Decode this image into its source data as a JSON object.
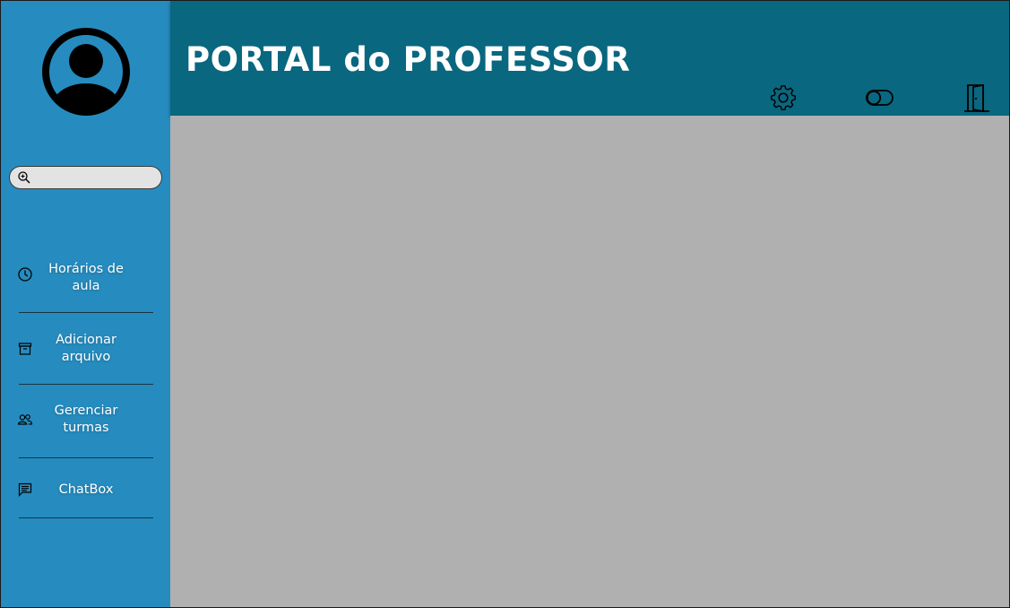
{
  "header": {
    "title": "PORTAL do PROFESSOR",
    "actions": [
      {
        "icon": "gear-icon",
        "label": "settings"
      },
      {
        "icon": "toggle-icon",
        "label": "theme-toggle"
      },
      {
        "icon": "door-exit-icon",
        "label": "logout"
      }
    ]
  },
  "sidebar": {
    "avatar_icon": "user-avatar-icon",
    "search": {
      "value": "",
      "placeholder": "",
      "icon": "zoom-in-icon"
    },
    "items": [
      {
        "label": "Horários de aula",
        "icon": "clock-icon"
      },
      {
        "label": "Adicionar arquivo",
        "icon": "archive-box-icon"
      },
      {
        "label": "Gerenciar turmas",
        "icon": "users-icon"
      },
      {
        "label": "ChatBox",
        "icon": "chat-icon"
      }
    ]
  },
  "colors": {
    "sidebar_bg": "#268cbf",
    "header_bg": "#09677f",
    "content_bg": "#b0b0b0",
    "search_bg": "#e3e3e3"
  }
}
